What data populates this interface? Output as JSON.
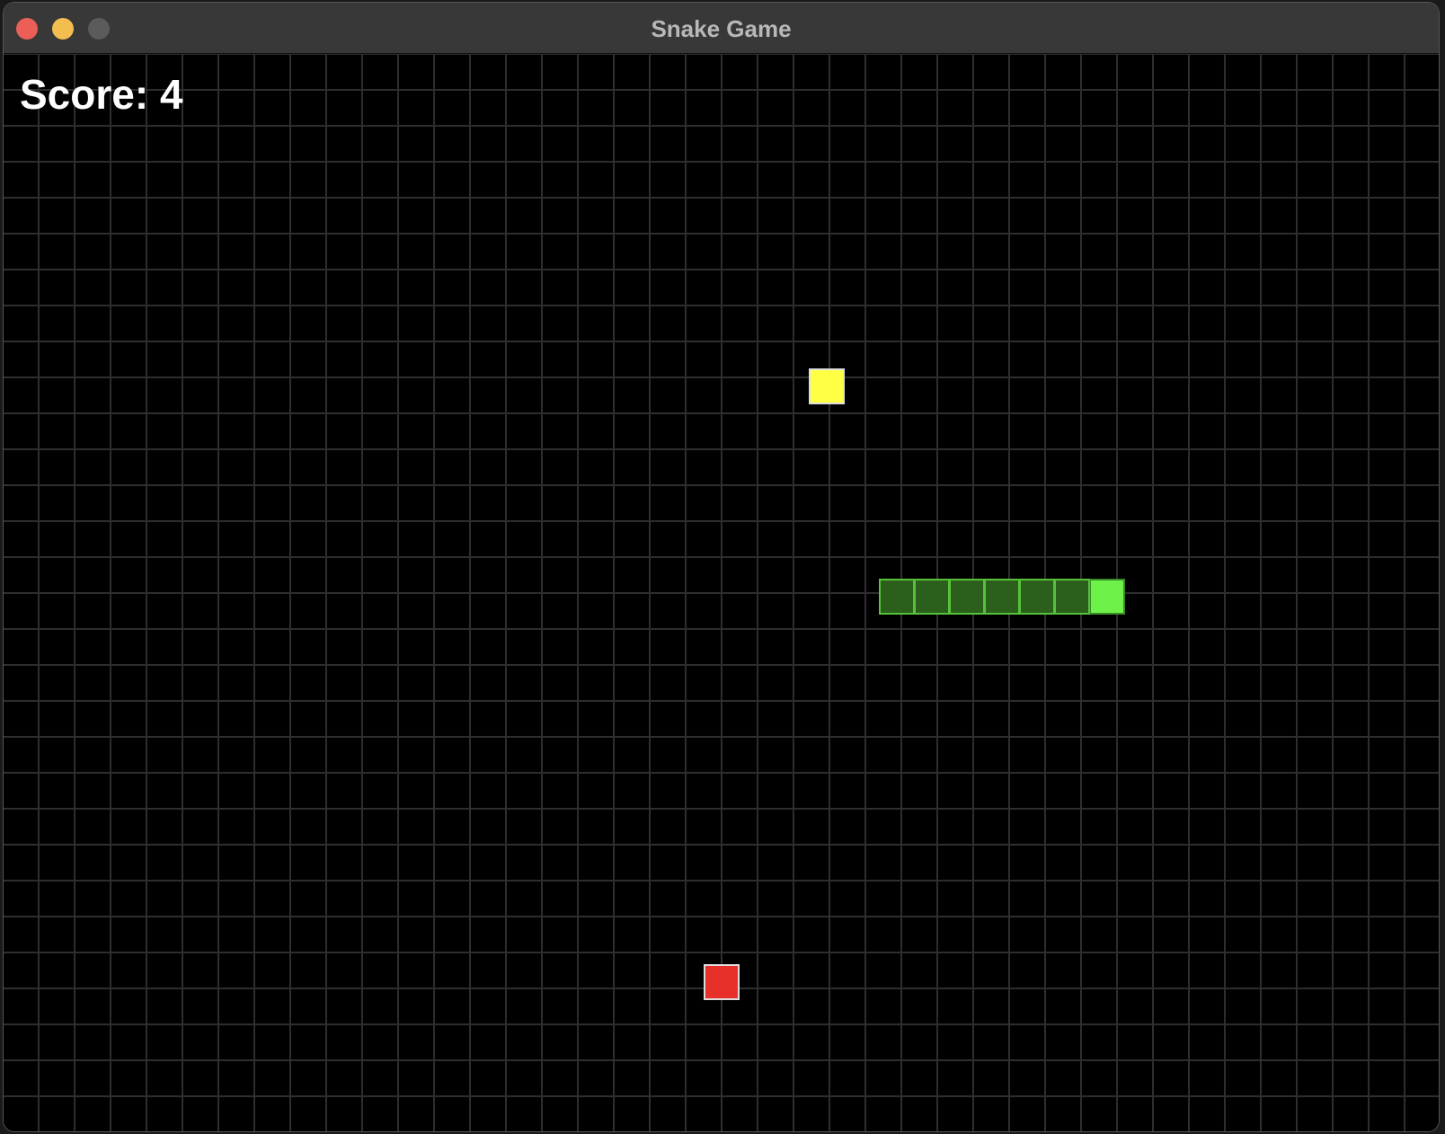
{
  "window": {
    "title": "Snake Game",
    "controls": {
      "close_color": "#ec5f57",
      "minimize_color": "#f4bd4f",
      "zoom_color": "#5b5b5b"
    }
  },
  "game": {
    "score_text": "Score: 4",
    "score": 4,
    "grid_color": "#2e2e2e",
    "background_color": "#000000",
    "snake": {
      "direction": "right",
      "head_color": "#6ef24a",
      "body_color": "#2c5e1c",
      "body_border_color": "#56c23a",
      "segments": [
        {
          "col": 31,
          "row": 15,
          "part": "head"
        },
        {
          "col": 30,
          "row": 15,
          "part": "body"
        },
        {
          "col": 29,
          "row": 15,
          "part": "body"
        },
        {
          "col": 28,
          "row": 15,
          "part": "body"
        },
        {
          "col": 27,
          "row": 15,
          "part": "body"
        },
        {
          "col": 26,
          "row": 15,
          "part": "body"
        },
        {
          "col": 25,
          "row": 15,
          "part": "body"
        }
      ]
    },
    "items": [
      {
        "type": "bonus-food",
        "color": "#ffff44",
        "col": 23,
        "row": 9
      },
      {
        "type": "food",
        "color": "#e8302a",
        "col": 20,
        "row": 26
      }
    ]
  }
}
